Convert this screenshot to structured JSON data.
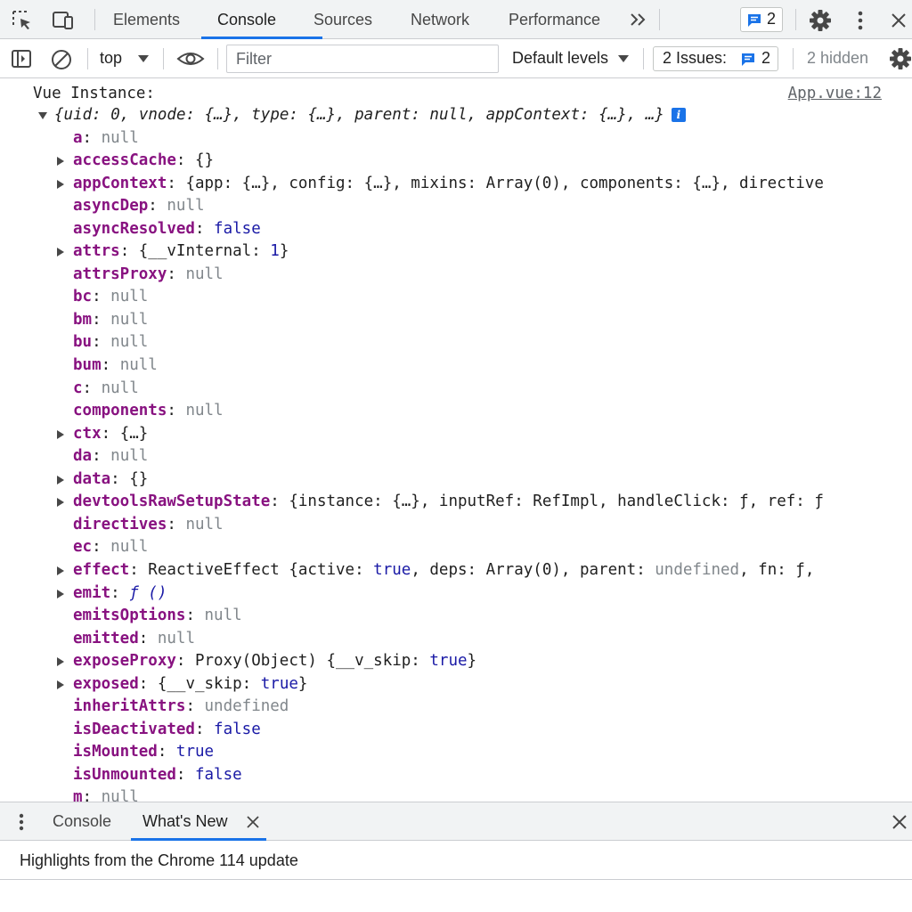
{
  "toolbar": {
    "tabs": [
      {
        "label": "Elements",
        "active": false
      },
      {
        "label": "Console",
        "active": true
      },
      {
        "label": "Sources",
        "active": false
      },
      {
        "label": "Network",
        "active": false
      },
      {
        "label": "Performance",
        "active": false
      }
    ],
    "more_tabs_icon": "double-chevron-right-icon",
    "message_count": "2"
  },
  "console_toolbar": {
    "context_label": "top",
    "filter_placeholder": "Filter",
    "levels_label": "Default levels",
    "issues_label": "2 Issues:",
    "issues_count": "2",
    "hidden_label": "2 hidden"
  },
  "console": {
    "log_message": "Vue Instance:",
    "source_link": "App.vue:12",
    "summary": "{uid: 0, vnode: {…}, type: {…}, parent: null, appContext: {…}, …}",
    "properties": [
      {
        "expandable": false,
        "key": "a",
        "parts": [
          {
            "t": "null",
            "c": "null"
          }
        ]
      },
      {
        "expandable": true,
        "key": "accessCache",
        "parts": [
          {
            "t": "{}",
            "c": "txt"
          }
        ]
      },
      {
        "expandable": true,
        "key": "appContext",
        "parts": [
          {
            "t": "{app: {…}, config: {…}, mixins: Array(0), components: {…}, directive",
            "c": "txt"
          }
        ]
      },
      {
        "expandable": false,
        "key": "asyncDep",
        "parts": [
          {
            "t": "null",
            "c": "null"
          }
        ]
      },
      {
        "expandable": false,
        "key": "asyncResolved",
        "parts": [
          {
            "t": "false",
            "c": "bool"
          }
        ]
      },
      {
        "expandable": true,
        "key": "attrs",
        "parts": [
          {
            "t": "{__vInternal: ",
            "c": "txt"
          },
          {
            "t": "1",
            "c": "num"
          },
          {
            "t": "}",
            "c": "txt"
          }
        ]
      },
      {
        "expandable": false,
        "key": "attrsProxy",
        "parts": [
          {
            "t": "null",
            "c": "null"
          }
        ]
      },
      {
        "expandable": false,
        "key": "bc",
        "parts": [
          {
            "t": "null",
            "c": "null"
          }
        ]
      },
      {
        "expandable": false,
        "key": "bm",
        "parts": [
          {
            "t": "null",
            "c": "null"
          }
        ]
      },
      {
        "expandable": false,
        "key": "bu",
        "parts": [
          {
            "t": "null",
            "c": "null"
          }
        ]
      },
      {
        "expandable": false,
        "key": "bum",
        "parts": [
          {
            "t": "null",
            "c": "null"
          }
        ]
      },
      {
        "expandable": false,
        "key": "c",
        "parts": [
          {
            "t": "null",
            "c": "null"
          }
        ]
      },
      {
        "expandable": false,
        "key": "components",
        "parts": [
          {
            "t": "null",
            "c": "null"
          }
        ]
      },
      {
        "expandable": true,
        "key": "ctx",
        "parts": [
          {
            "t": "{…}",
            "c": "txt"
          }
        ]
      },
      {
        "expandable": false,
        "key": "da",
        "parts": [
          {
            "t": "null",
            "c": "null"
          }
        ]
      },
      {
        "expandable": true,
        "key": "data",
        "parts": [
          {
            "t": "{}",
            "c": "txt"
          }
        ]
      },
      {
        "expandable": true,
        "key": "devtoolsRawSetupState",
        "parts": [
          {
            "t": "{instance: {…}, inputRef: RefImpl, handleClick: ƒ, ref: ƒ",
            "c": "txt"
          }
        ]
      },
      {
        "expandable": false,
        "key": "directives",
        "parts": [
          {
            "t": "null",
            "c": "null"
          }
        ]
      },
      {
        "expandable": false,
        "key": "ec",
        "parts": [
          {
            "t": "null",
            "c": "null"
          }
        ]
      },
      {
        "expandable": true,
        "key": "effect",
        "parts": [
          {
            "t": "ReactiveEffect {active: ",
            "c": "txt"
          },
          {
            "t": "true",
            "c": "bool"
          },
          {
            "t": ", deps: Array(0), parent: ",
            "c": "txt"
          },
          {
            "t": "undefined",
            "c": "null"
          },
          {
            "t": ", fn: ƒ,",
            "c": "txt"
          }
        ]
      },
      {
        "expandable": true,
        "key": "emit",
        "parts": [
          {
            "t": "ƒ ()",
            "c": "fn"
          }
        ]
      },
      {
        "expandable": false,
        "key": "emitsOptions",
        "parts": [
          {
            "t": "null",
            "c": "null"
          }
        ]
      },
      {
        "expandable": false,
        "key": "emitted",
        "parts": [
          {
            "t": "null",
            "c": "null"
          }
        ]
      },
      {
        "expandable": true,
        "key": "exposeProxy",
        "parts": [
          {
            "t": "Proxy(Object) {__v_skip: ",
            "c": "txt"
          },
          {
            "t": "true",
            "c": "bool"
          },
          {
            "t": "}",
            "c": "txt"
          }
        ]
      },
      {
        "expandable": true,
        "key": "exposed",
        "parts": [
          {
            "t": "{__v_skip: ",
            "c": "txt"
          },
          {
            "t": "true",
            "c": "bool"
          },
          {
            "t": "}",
            "c": "txt"
          }
        ]
      },
      {
        "expandable": false,
        "key": "inheritAttrs",
        "parts": [
          {
            "t": "undefined",
            "c": "null"
          }
        ]
      },
      {
        "expandable": false,
        "key": "isDeactivated",
        "parts": [
          {
            "t": "false",
            "c": "bool"
          }
        ]
      },
      {
        "expandable": false,
        "key": "isMounted",
        "parts": [
          {
            "t": "true",
            "c": "bool"
          }
        ]
      },
      {
        "expandable": false,
        "key": "isUnmounted",
        "parts": [
          {
            "t": "false",
            "c": "bool"
          }
        ]
      },
      {
        "expandable": false,
        "key": "m",
        "parts": [
          {
            "t": "null",
            "c": "null"
          }
        ]
      }
    ]
  },
  "drawer": {
    "tabs": [
      {
        "label": "Console",
        "active": false
      },
      {
        "label": "What's New",
        "active": true
      }
    ],
    "highlight": "Highlights from the Chrome 114 update"
  },
  "colors": {
    "accent": "#1a73e8",
    "property_key": "#881280",
    "value_literal": "#1a1aa6",
    "value_null": "#80868b"
  }
}
